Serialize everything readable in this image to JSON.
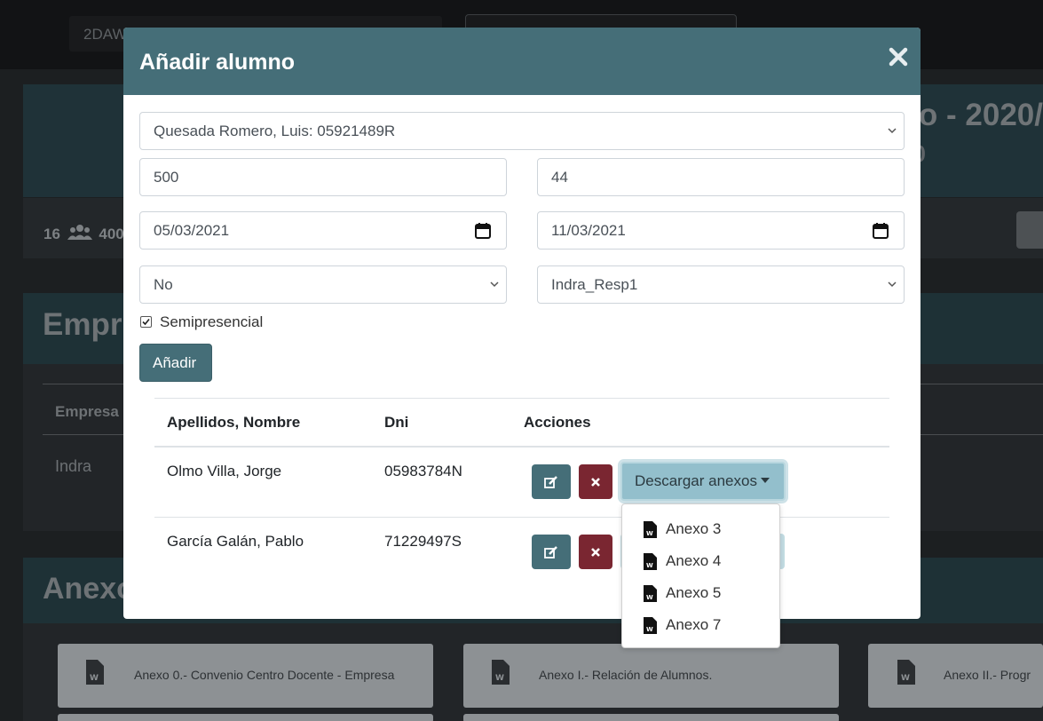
{
  "background": {
    "course_chip": "2DAW",
    "hero_title": "o - 2020/",
    "hero_subtitle": "0",
    "stats": {
      "count": "16",
      "secondary": "400"
    },
    "empresas_title": "Empr",
    "empresas_table": {
      "header": "Empresa",
      "row": "Indra"
    },
    "anexos_title": "Anexo",
    "anexo_cards": [
      "Anexo 0.- Convenio Centro Docente - Empresa",
      "Anexo I.- Relación de Alumnos.",
      "Anexo II.- Progr"
    ]
  },
  "modal": {
    "title": "Añadir alumno",
    "student_select": "Quesada Romero, Luis: 05921489R",
    "hours_field": "500",
    "second_field": "44",
    "start_date": "05/03/2021",
    "end_date": "11/03/2021",
    "option_select": "No",
    "responsible_select": "Indra_Resp1",
    "semipresencial_label": "Semipresencial",
    "semipresencial_checked": true,
    "add_button": "Añadir",
    "table": {
      "headers": [
        "Apellidos, Nombre",
        "Dni",
        "Acciones"
      ],
      "rows": [
        {
          "name": "Olmo Villa, Jorge",
          "dni": "05983784N"
        },
        {
          "name": "García Galán, Pablo",
          "dni": "71229497S"
        }
      ]
    },
    "download_button": "Descargar anexos",
    "dropdown_items": [
      "Anexo 3",
      "Anexo 4",
      "Anexo 5",
      "Anexo 7"
    ]
  },
  "colors": {
    "primary": "#456e78",
    "danger": "#7a2631",
    "download": "#93bfcc"
  }
}
